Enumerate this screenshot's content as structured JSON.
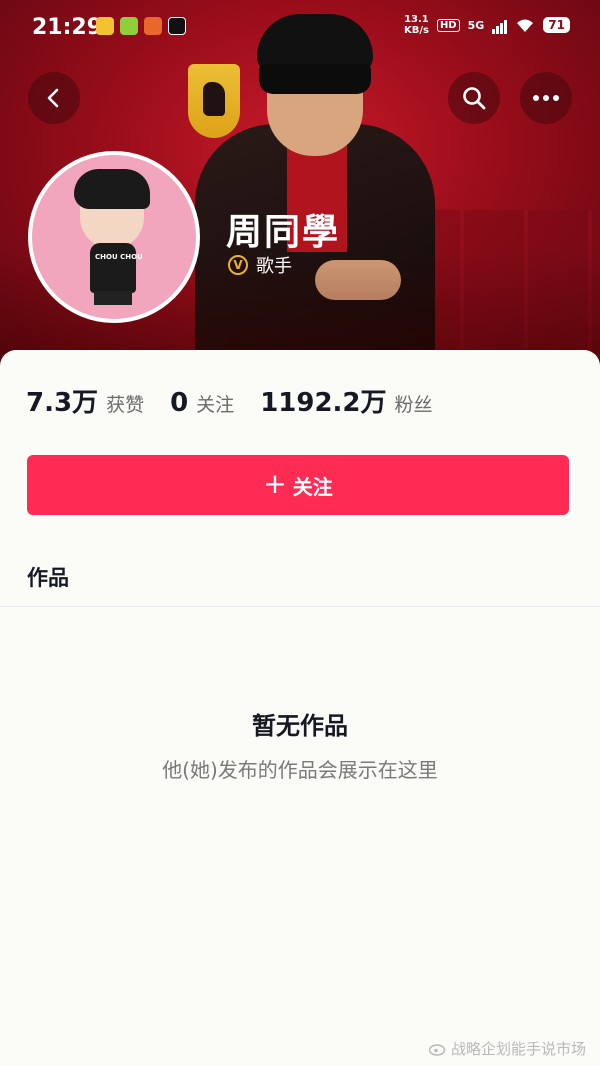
{
  "status_bar": {
    "time": "21:29",
    "net_speed_value": "13.1",
    "net_speed_unit": "KB/s",
    "hd": "HD",
    "network": "5G",
    "battery": "71"
  },
  "profile": {
    "name": "周同學",
    "verification": "歌手",
    "avatar_shirt_text": "CHOU CHOU"
  },
  "stats": [
    {
      "value": "7.3万",
      "label": "获赞"
    },
    {
      "value": "0",
      "label": "关注"
    },
    {
      "value": "1192.2万",
      "label": "粉丝"
    }
  ],
  "follow_button": {
    "label": "关注"
  },
  "tabs": {
    "works": "作品"
  },
  "empty_state": {
    "title": "暂无作品",
    "subtitle": "他(她)发布的作品会展示在这里"
  },
  "watermark": "战略企划能手说市场",
  "colors": {
    "accent": "#fe2c55",
    "banner": "#b3121f",
    "verify_gold": "#e8b130"
  }
}
